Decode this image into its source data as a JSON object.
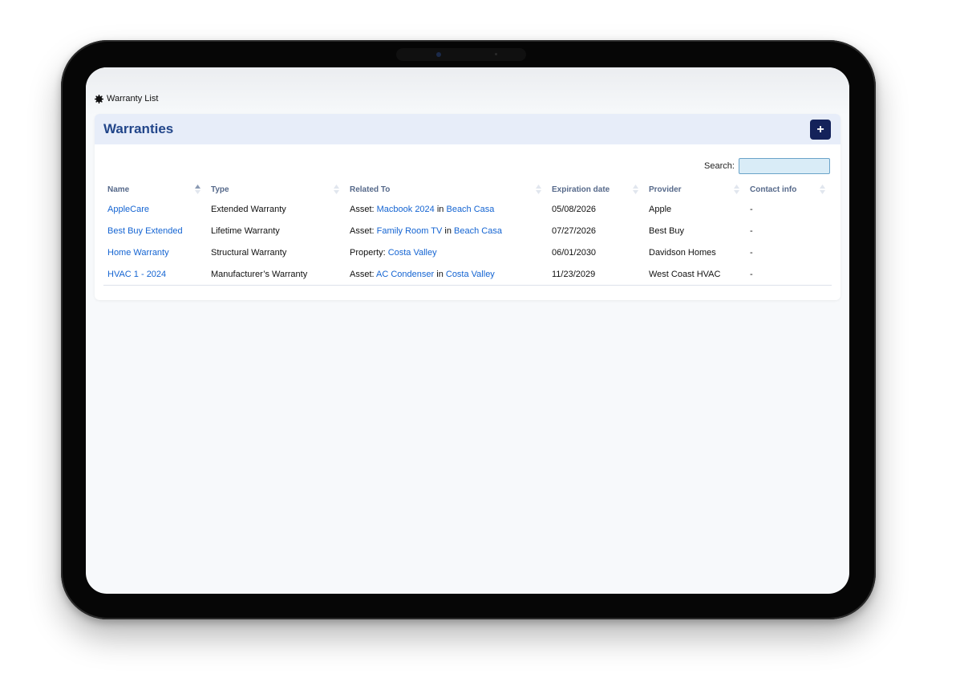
{
  "breadcrumb": {
    "icon": "gear-icon",
    "label": "Warranty List"
  },
  "card": {
    "title": "Warranties",
    "add_label": "+"
  },
  "search": {
    "label": "Search:",
    "value": "",
    "placeholder": ""
  },
  "table": {
    "columns": [
      "Name",
      "Type",
      "Related To",
      "Expiration date",
      "Provider",
      "Contact info"
    ],
    "sorted_column": "Name",
    "rows": [
      {
        "name": "AppleCare",
        "type": "Extended Warranty",
        "related_prefix": "Asset: ",
        "related_item": "Macbook 2024",
        "related_sep": " in ",
        "related_location": "Beach Casa",
        "expiration": "05/08/2026",
        "provider": "Apple",
        "contact": "-"
      },
      {
        "name": "Best Buy Extended",
        "type": "Lifetime Warranty",
        "related_prefix": "Asset: ",
        "related_item": "Family Room TV",
        "related_sep": " in ",
        "related_location": "Beach Casa",
        "expiration": "07/27/2026",
        "provider": "Best Buy",
        "contact": "-"
      },
      {
        "name": "Home Warranty",
        "type": "Structural Warranty",
        "related_prefix": "Property: ",
        "related_item": "Costa Valley",
        "related_sep": "",
        "related_location": "",
        "expiration": "06/01/2030",
        "provider": "Davidson Homes",
        "contact": "-"
      },
      {
        "name": "HVAC 1 - 2024",
        "type": "Manufacturer’s Warranty",
        "related_prefix": "Asset: ",
        "related_item": "AC Condenser",
        "related_sep": " in ",
        "related_location": "Costa Valley",
        "expiration": "11/23/2029",
        "provider": "West Coast HVAC",
        "contact": "-"
      }
    ]
  },
  "colors": {
    "title": "#22468a",
    "header_bg": "#e7edf9",
    "link": "#1464d2",
    "add_button": "#14225a",
    "search_bg": "#d9ecf7"
  }
}
